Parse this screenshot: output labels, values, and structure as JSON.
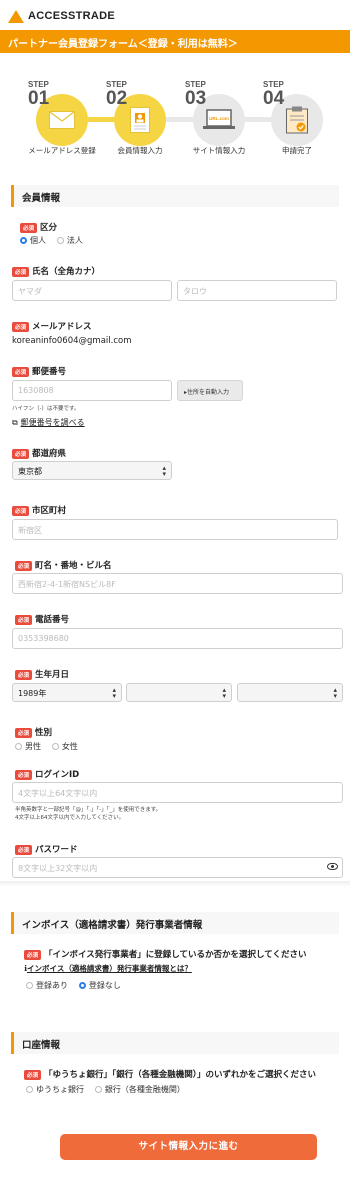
{
  "header": {
    "logo_text": "ACCESSTRADE",
    "banner": "パートナー会員登録フォーム＜登録・利用は無料＞"
  },
  "steps": [
    {
      "step_word": "STEP",
      "num": "01",
      "caption": "メールアドレス登録",
      "icon": "envelope-icon",
      "done": true
    },
    {
      "step_word": "STEP",
      "num": "02",
      "caption": "会員情報入力",
      "icon": "document-profile-icon",
      "done": true
    },
    {
      "step_word": "STEP",
      "num": "03",
      "caption": "サイト情報入力",
      "icon": "laptop-icon",
      "icon_text": "URL.com",
      "done": false
    },
    {
      "step_word": "STEP",
      "num": "04",
      "caption": "申請完了",
      "icon": "clipboard-check-icon",
      "done": false
    }
  ],
  "colors": {
    "accent": "#f39800",
    "step_active": "#f5d544",
    "step_inactive": "#e8e8e8",
    "required": "#e94b3c",
    "submit": "#f06b3a",
    "radio_selected": "#2b7de9"
  },
  "required_badge": "必須",
  "member": {
    "section_title": "会員情報",
    "category": {
      "label": "区分",
      "options": [
        "個人",
        "法人"
      ],
      "selected": "個人"
    },
    "name_kana": {
      "label": "氏名（全角カナ）",
      "last_placeholder": "ヤマダ",
      "first_placeholder": "タロウ"
    },
    "email": {
      "label": "メールアドレス",
      "value": "koreaninfo0604@gmail.com"
    },
    "postal": {
      "label": "郵便番号",
      "placeholder": "1630808",
      "autofill_button": "住所を自動入力",
      "note": "ハイフン（-）は不要です。",
      "lookup_link": "郵便番号を調べる"
    },
    "prefecture": {
      "label": "都道府県",
      "value": "東京都"
    },
    "city": {
      "label": "市区町村",
      "placeholder": "新宿区"
    },
    "address": {
      "label": "町名・番地・ビル名",
      "placeholder": "西新宿2-4-1新宿NSビル8F"
    },
    "phone": {
      "label": "電話番号",
      "placeholder": "0353398680"
    },
    "birthdate": {
      "label": "生年月日",
      "year": "1989年",
      "month": "",
      "day": ""
    },
    "gender": {
      "label": "性別",
      "options": [
        "男性",
        "女性"
      ]
    },
    "login_id": {
      "label": "ログインID",
      "placeholder": "4文字以上64文字以内",
      "note1": "半角英数字と一部記号「@」「.」「-」「_」を使用できます。",
      "note2": "4文字以上64文字以内で入力してください。"
    },
    "password": {
      "label": "パスワード",
      "placeholder": "8文字以上32文字以内"
    }
  },
  "invoice": {
    "section_title": "インボイス（適格請求書）発行事業者情報",
    "question": "「インボイス発行事業者」に登録しているか否かを選択してください",
    "help_link": "インボイス（適格請求書）発行事業者情報とは？",
    "options": [
      "登録あり",
      "登録なし"
    ],
    "selected": "登録なし"
  },
  "bank": {
    "section_title": "口座情報",
    "question": "「ゆうちょ銀行」「銀行（各種金融機関）」のいずれかをご選択ください",
    "options": [
      "ゆうちょ銀行",
      "銀行（各種金融機関）"
    ]
  },
  "submit_label": "サイト情報入力に進む"
}
